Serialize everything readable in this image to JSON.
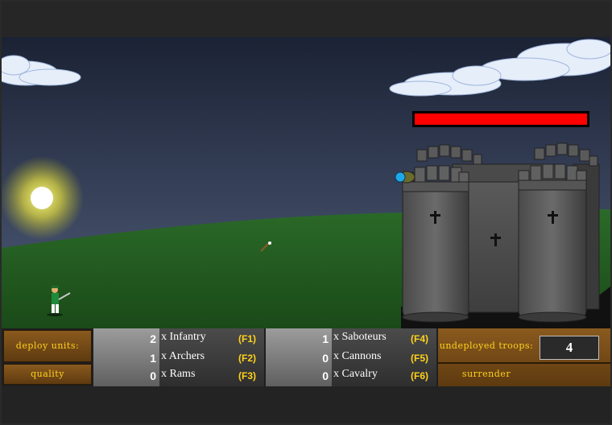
{
  "hud": {
    "deploy_units_label": "deploy units:",
    "quality_label": "quality",
    "undeployed_troops_label": "undeployed troops:",
    "surrender_label": "surrender",
    "undeployed_troops_value": "4",
    "units_left": [
      {
        "count": "2",
        "label": "x Infantry",
        "key": "(F1)"
      },
      {
        "count": "1",
        "label": "x Archers",
        "key": "(F2)"
      },
      {
        "count": "0",
        "label": "x Rams",
        "key": "(F3)"
      }
    ],
    "units_right": [
      {
        "count": "1",
        "label": "x Saboteurs",
        "key": "(F4)"
      },
      {
        "count": "0",
        "label": "x Cannons",
        "key": "(F5)"
      },
      {
        "count": "0",
        "label": "x Cavalry",
        "key": "(F6)"
      }
    ]
  },
  "castle": {
    "health_fraction": 1.0,
    "health_color": "#ff0000"
  },
  "colors": {
    "sky_top": "#1c2436",
    "sky_bottom": "#4d5a76",
    "grass": "#255c23",
    "button_text": "#ffd21a"
  }
}
